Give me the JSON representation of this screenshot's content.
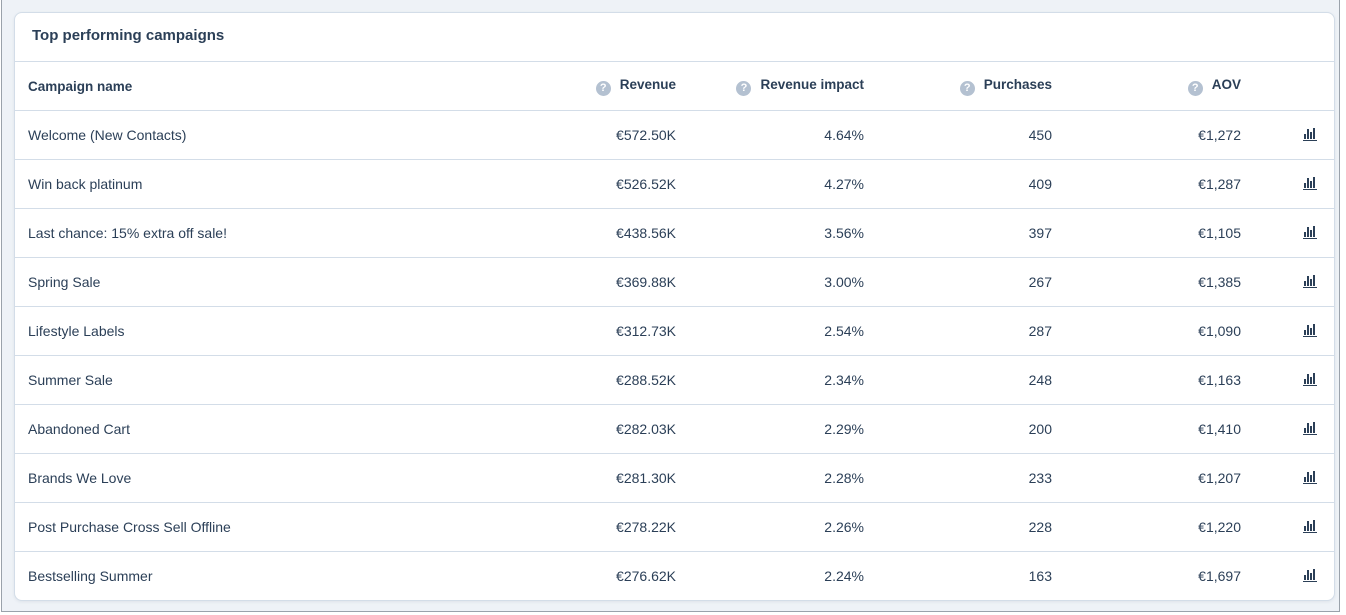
{
  "card": {
    "title": "Top performing campaigns"
  },
  "table": {
    "columns": [
      {
        "label": "Campaign name",
        "help": false
      },
      {
        "label": "Revenue",
        "help": true
      },
      {
        "label": "Revenue impact",
        "help": true
      },
      {
        "label": "Purchases",
        "help": true
      },
      {
        "label": "AOV",
        "help": true
      }
    ],
    "help_glyph": "?",
    "row_action_icon": "bar-chart-icon",
    "rows": [
      {
        "name": "Welcome (New Contacts)",
        "revenue": "€572.50K",
        "impact": "4.64%",
        "purchases": "450",
        "aov": "€1,272"
      },
      {
        "name": "Win back platinum",
        "revenue": "€526.52K",
        "impact": "4.27%",
        "purchases": "409",
        "aov": "€1,287"
      },
      {
        "name": "Last chance: 15% extra off sale!",
        "revenue": "€438.56K",
        "impact": "3.56%",
        "purchases": "397",
        "aov": "€1,105"
      },
      {
        "name": "Spring Sale",
        "revenue": "€369.88K",
        "impact": "3.00%",
        "purchases": "267",
        "aov": "€1,385"
      },
      {
        "name": "Lifestyle Labels",
        "revenue": "€312.73K",
        "impact": "2.54%",
        "purchases": "287",
        "aov": "€1,090"
      },
      {
        "name": "Summer Sale",
        "revenue": "€288.52K",
        "impact": "2.34%",
        "purchases": "248",
        "aov": "€1,163"
      },
      {
        "name": "Abandoned Cart",
        "revenue": "€282.03K",
        "impact": "2.29%",
        "purchases": "200",
        "aov": "€1,410"
      },
      {
        "name": "Brands We Love",
        "revenue": "€281.30K",
        "impact": "2.28%",
        "purchases": "233",
        "aov": "€1,207"
      },
      {
        "name": "Post Purchase Cross Sell Offline",
        "revenue": "€278.22K",
        "impact": "2.26%",
        "purchases": "228",
        "aov": "€1,220"
      },
      {
        "name": "Bestselling Summer",
        "revenue": "€276.62K",
        "impact": "2.24%",
        "purchases": "163",
        "aov": "€1,697"
      }
    ]
  },
  "colors": {
    "text": "#2b3f57",
    "border": "#d3dde8",
    "help_icon": "#b4c1d1",
    "page_bg": "#eef2f7"
  }
}
